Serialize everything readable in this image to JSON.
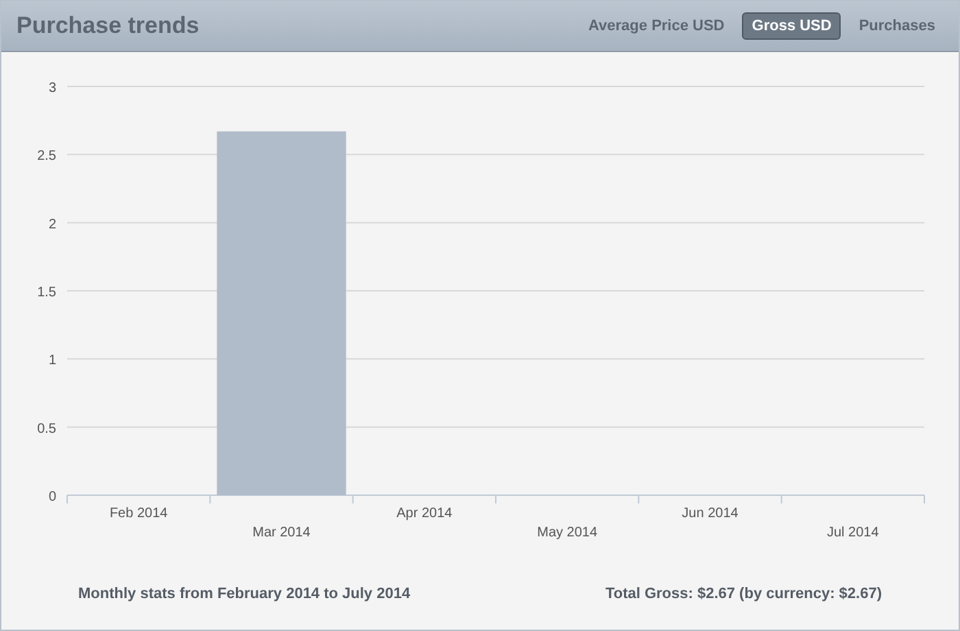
{
  "title": "Purchase trends",
  "tabs": [
    {
      "label": "Average Price USD",
      "selected": false
    },
    {
      "label": "Gross USD",
      "selected": true
    },
    {
      "label": "Purchases",
      "selected": false
    }
  ],
  "chart_data": {
    "type": "bar",
    "categories": [
      "Feb 2014",
      "Mar 2014",
      "Apr 2014",
      "May 2014",
      "Jun 2014",
      "Jul 2014"
    ],
    "values": [
      0,
      2.67,
      0,
      0,
      0,
      0
    ],
    "ylim": [
      0,
      3
    ],
    "grid": true,
    "yticks": [
      {
        "value": 0,
        "label": "0"
      },
      {
        "value": 0.5,
        "label": "0.5"
      },
      {
        "value": 1,
        "label": "1"
      },
      {
        "value": 1.5,
        "label": "1.5"
      },
      {
        "value": 2,
        "label": "2"
      },
      {
        "value": 2.5,
        "label": "2.5"
      },
      {
        "value": 3,
        "label": "3"
      }
    ]
  },
  "summary": "Monthly stats from February 2014 to July 2014",
  "total": "Total Gross: $2.67 (by currency: $2.67)"
}
